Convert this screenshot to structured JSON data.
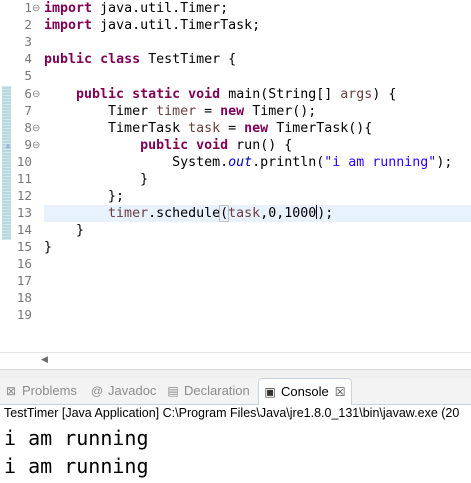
{
  "editor": {
    "line_numbers": [
      "1",
      "2",
      "3",
      "4",
      "5",
      "6",
      "7",
      "8",
      "9",
      "10",
      "11",
      "12",
      "13",
      "14",
      "15",
      "16",
      "17",
      "18",
      "19"
    ],
    "code": {
      "l1_kw": "import",
      "l1_rest": " java.util.Timer;",
      "l2_kw": "import",
      "l2_rest": " java.util.TimerTask;",
      "l4_kw1": "public",
      "l4_sp1": " ",
      "l4_kw2": "class",
      "l4_rest": " TestTimer {",
      "l6_kw1": "public",
      "l6_kw2": "static",
      "l6_kw3": "void",
      "l6_a": " main(String[] ",
      "l6_var": "args",
      "l6_b": ") {",
      "l7_a": "Timer ",
      "l7_var": "timer",
      "l7_b": " = ",
      "l7_kw": "new",
      "l7_c": " Timer();",
      "l8_a": "TimerTask ",
      "l8_var": "task",
      "l8_b": " = ",
      "l8_kw": "new",
      "l8_c": " TimerTask(){",
      "l9_kw1": "public",
      "l9_kw2": "void",
      "l9_rest": " run() {",
      "l10_a": "System.",
      "l10_field": "out",
      "l10_b": ".println(",
      "l10_str": "\"i am running\"",
      "l10_c": ");",
      "l11": "}",
      "l12": "};",
      "l13_var1": "timer",
      "l13_a": ".schedule",
      "l13_paren": "(",
      "l13_var2": "task",
      "l13_b": ",0,1000",
      "l13_c": ");",
      "l14": "}",
      "l15": "}"
    }
  },
  "views": {
    "tabs": [
      {
        "label": "Problems",
        "icon": "problems-icon"
      },
      {
        "label": "Javadoc",
        "icon": "at-icon"
      },
      {
        "label": "Declaration",
        "icon": "declaration-icon"
      },
      {
        "label": "Console",
        "icon": "console-icon"
      }
    ],
    "close_glyph": "☒"
  },
  "console": {
    "header": "TestTimer [Java Application] C:\\Program Files\\Java\\jre1.8.0_131\\bin\\javaw.exe (20",
    "output": [
      "i am running",
      "i am running"
    ]
  },
  "colors": {
    "keyword": "#7f0055",
    "string": "#2a00ff",
    "field": "#0000c0",
    "local_var": "#6a3e3e",
    "current_line": "#e8f2fe"
  }
}
